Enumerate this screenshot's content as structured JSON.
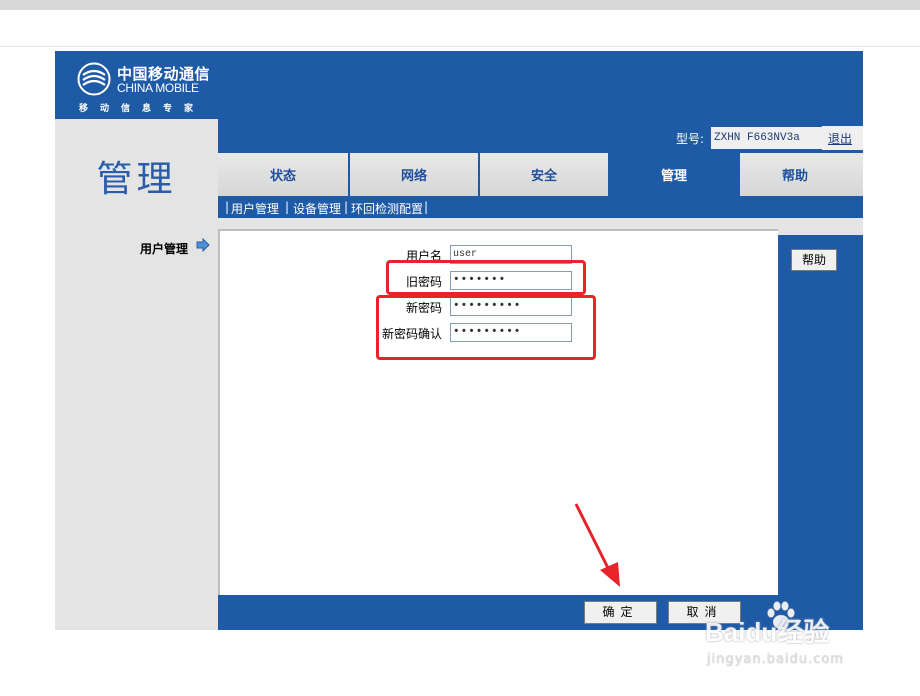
{
  "brand": {
    "name_cn": "中国移动通信",
    "name_en": "CHINA MOBILE",
    "slogan": "移动信息专家"
  },
  "page_title": "管理",
  "info_bar": {
    "model_label": "型号:",
    "model_value": "ZXHN F663NV3a",
    "logout": "退出"
  },
  "tabs": [
    {
      "label": "状态",
      "active": false
    },
    {
      "label": "网络",
      "active": false
    },
    {
      "label": "安全",
      "active": false
    },
    {
      "label": "管理",
      "active": true
    },
    {
      "label": "帮助",
      "active": false
    }
  ],
  "subnav": [
    {
      "label": "用户管理",
      "current": true
    },
    {
      "label": "设备管理",
      "current": false
    },
    {
      "label": "环回检测配置",
      "current": false
    }
  ],
  "sidebar": {
    "item": "用户管理"
  },
  "form": {
    "username_label": "用户名",
    "username_value": "user",
    "old_password_label": "旧密码",
    "old_password_value": "•••••••",
    "new_password_label": "新密码",
    "new_password_value": "•••••••••",
    "confirm_password_label": "新密码确认",
    "confirm_password_value": "•••••••••"
  },
  "help_button": "帮助",
  "actions": {
    "confirm": "确定",
    "cancel": "取消"
  },
  "watermark": {
    "main": "Baidu经验",
    "sub": "jingyan.baidu.com"
  },
  "colors": {
    "brand_blue": "#1f5aa7",
    "panel_gray": "#e4e4e4",
    "highlight_red": "#e8232a"
  }
}
